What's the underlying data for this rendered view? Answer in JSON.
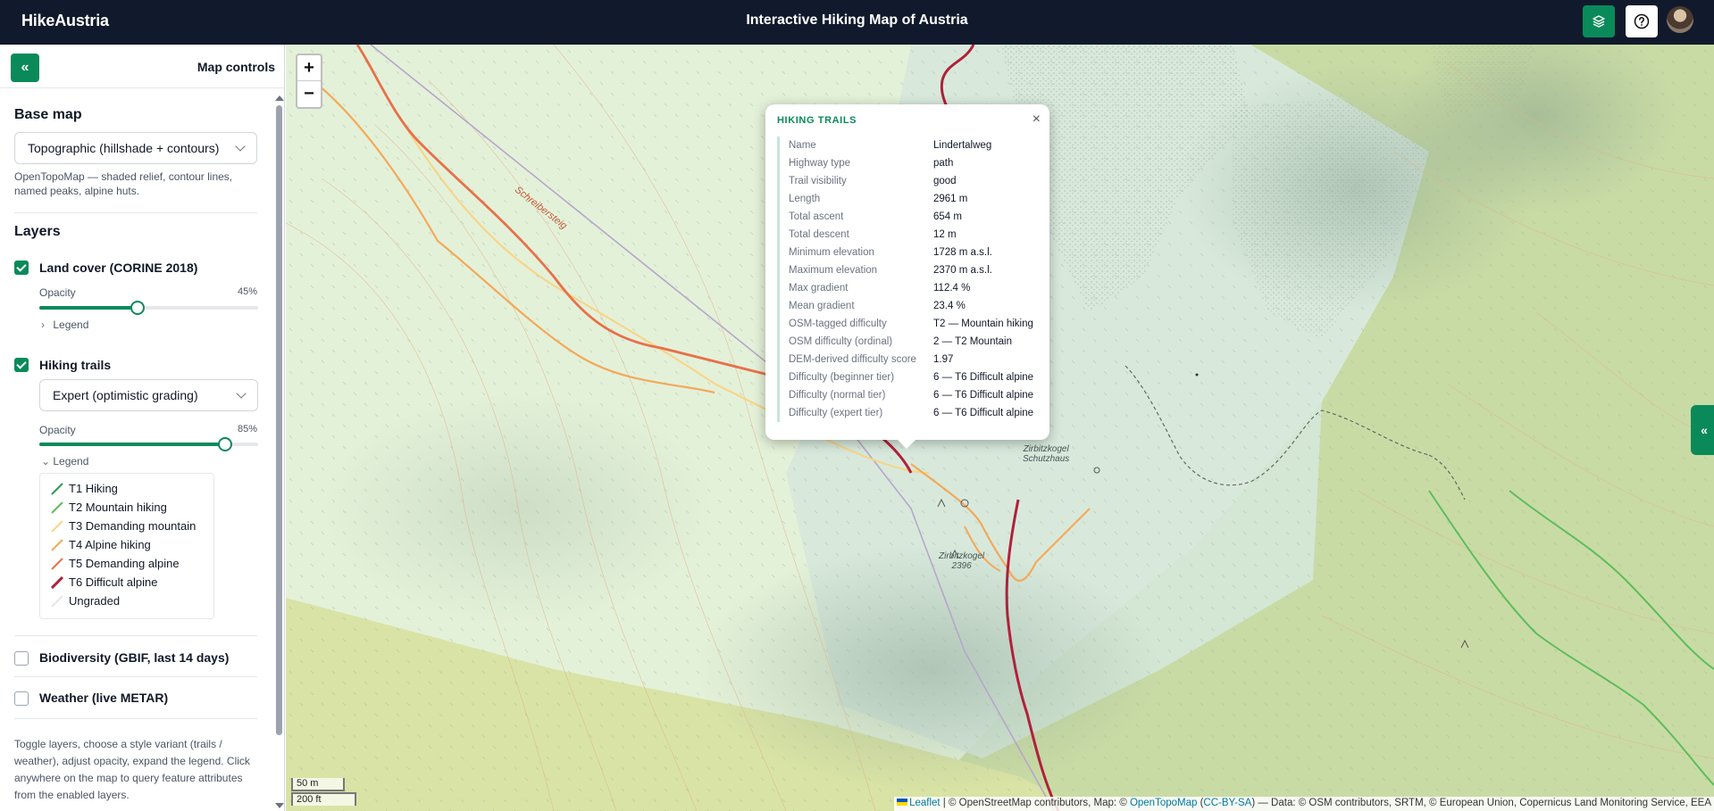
{
  "header": {
    "brand": "HikeAustria",
    "title": "Interactive Hiking Map of Austria",
    "layers_icon": "layers-icon",
    "help_icon": "help-circle-icon",
    "avatar_icon": "user-avatar"
  },
  "sidebar": {
    "title": "Map controls",
    "collapse_icon": "chevrons-left-icon",
    "base_map": {
      "heading": "Base map",
      "selected": "Topographic (hillshade + contours)",
      "description": "OpenTopoMap — shaded relief, contour lines, named peaks, alpine huts."
    },
    "layers": {
      "heading": "Layers",
      "land_cover": {
        "label": "Land cover (CORINE 2018)",
        "checked": true,
        "opacity_label": "Opacity",
        "opacity_text": "45%",
        "opacity": 45,
        "legend_label": "Legend",
        "legend_expanded": false
      },
      "hiking_trails": {
        "label": "Hiking trails",
        "checked": true,
        "variant": "Expert (optimistic grading)",
        "opacity_label": "Opacity",
        "opacity_text": "85%",
        "opacity": 85,
        "legend_label": "Legend",
        "legend_expanded": true,
        "legend": [
          {
            "label": "T1 Hiking",
            "color": "#2e9a52"
          },
          {
            "label": "T2 Mountain hiking",
            "color": "#5dbd5d"
          },
          {
            "label": "T3 Demanding mountain",
            "color": "#f7d58a"
          },
          {
            "label": "T4 Alpine hiking",
            "color": "#f3a95a"
          },
          {
            "label": "T5 Demanding alpine",
            "color": "#e8704a"
          },
          {
            "label": "T6 Difficult alpine",
            "color": "#b0203a"
          },
          {
            "label": "Ungraded",
            "color": "#e5e7eb"
          }
        ]
      },
      "biodiversity": {
        "label": "Biodiversity (GBIF, last 14 days)",
        "checked": false
      },
      "weather": {
        "label": "Weather (live METAR)",
        "checked": false
      }
    },
    "help_text": "Toggle layers, choose a style variant (trails / weather), adjust opacity, expand the legend. Click anywhere on the map to query feature attributes from the enabled layers."
  },
  "map": {
    "zoom_in": "+",
    "zoom_out": "−",
    "labels": {
      "peak_name": "Zirbitzkogel",
      "peak_elev": "2396",
      "hut_name": "Zirbitzkogel",
      "hut_sub": "Schutzhaus",
      "trail_name": "Schreibersteig"
    },
    "scale_m": "50 m",
    "scale_ft": "200 ft",
    "attribution": {
      "leaflet": "Leaflet",
      "text1": " | © OpenStreetMap contributors, Map: © ",
      "opentopomap": "OpenTopoMap",
      "cc": "CC-BY-SA",
      "text2": " — Data: © OSM contributors, SRTM, © European Union, Copernicus Land Monitoring Service, EEA"
    },
    "side_tab_icon": "chevrons-left-icon",
    "colors": {
      "accent": "#0a8a5a",
      "header": "#111a2c"
    }
  },
  "popup": {
    "title": "HIKING TRAILS",
    "close": "×",
    "rows": [
      {
        "k": "Name",
        "v": "Lindertalweg"
      },
      {
        "k": "Highway type",
        "v": "path"
      },
      {
        "k": "Trail visibility",
        "v": "good"
      },
      {
        "k": "Length",
        "v": "2961 m"
      },
      {
        "k": "Total ascent",
        "v": "654 m"
      },
      {
        "k": "Total descent",
        "v": "12 m"
      },
      {
        "k": "Minimum elevation",
        "v": "1728 m a.s.l."
      },
      {
        "k": "Maximum elevation",
        "v": "2370 m a.s.l."
      },
      {
        "k": "Max gradient",
        "v": "112.4 %"
      },
      {
        "k": "Mean gradient",
        "v": "23.4 %"
      },
      {
        "k": "OSM-tagged difficulty",
        "v": "T2 — Mountain hiking"
      },
      {
        "k": "OSM difficulty (ordinal)",
        "v": "2 — T2 Mountain"
      },
      {
        "k": "DEM-derived difficulty score",
        "v": "1.97"
      },
      {
        "k": "Difficulty (beginner tier)",
        "v": "6 — T6 Difficult alpine"
      },
      {
        "k": "Difficulty (normal tier)",
        "v": "6 — T6 Difficult alpine"
      },
      {
        "k": "Difficulty (expert tier)",
        "v": "6 — T6 Difficult alpine"
      }
    ]
  }
}
